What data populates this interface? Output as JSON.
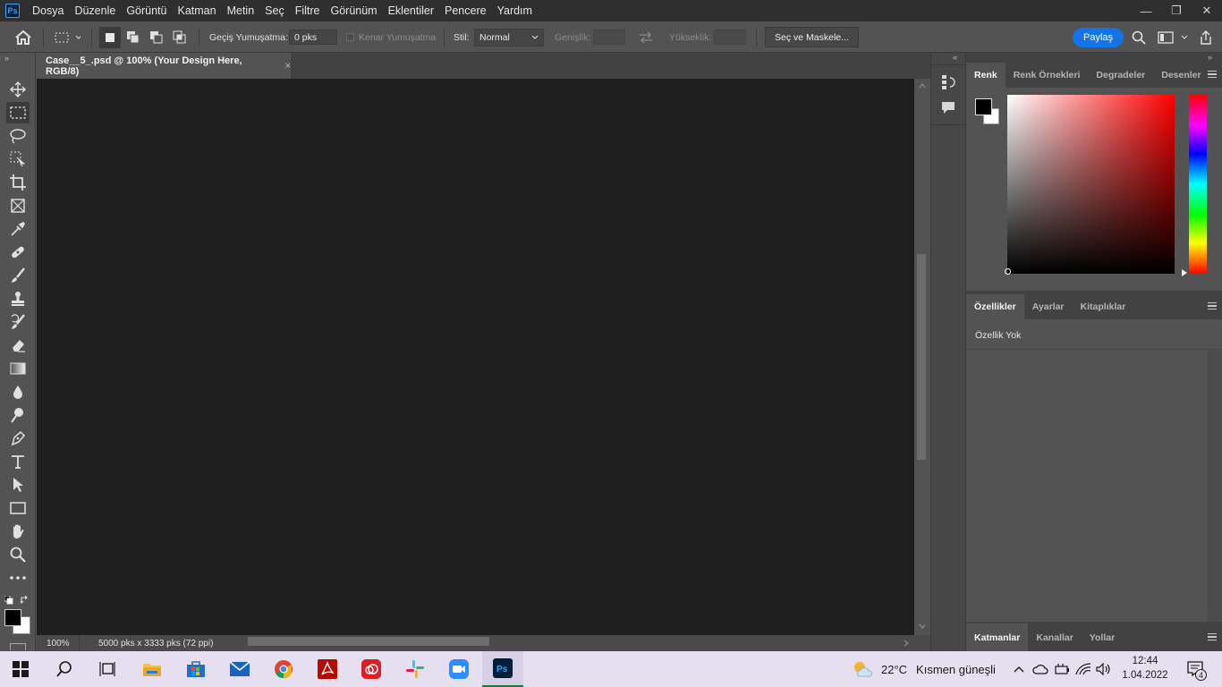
{
  "app": {
    "logo_text": "Ps"
  },
  "menubar": {
    "items": [
      "Dosya",
      "Düzenle",
      "Görüntü",
      "Katman",
      "Metin",
      "Seç",
      "Filtre",
      "Görünüm",
      "Eklentiler",
      "Pencere",
      "Yardım"
    ]
  },
  "window_controls": {
    "minimize": "—",
    "restore": "❐",
    "close": "✕"
  },
  "options": {
    "feather_label": "Geçiş Yumuşatma:",
    "feather_value": "0 pks",
    "antialias_label": "Kenar Yumuşatma",
    "style_label": "Stil:",
    "style_value": "Normal",
    "width_label": "Genişlik:",
    "height_label": "Yükseklik:",
    "select_mask_label": "Seç ve Maskele...",
    "share_label": "Paylaş"
  },
  "document": {
    "tab_title": "Case__5_.psd @ 100% (Your Design Here, RGB/8)",
    "tab_close": "×",
    "zoom": "100%",
    "info": "5000 pks x 3333 pks (72 ppi)"
  },
  "panels": {
    "color_tabs": [
      "Renk",
      "Renk Örnekleri",
      "Degradeler",
      "Desenler"
    ],
    "props_tabs": [
      "Özellikler",
      "Ayarlar",
      "Kitaplıklar"
    ],
    "props_empty": "Özellik Yok",
    "layers_tabs": [
      "Katmanlar",
      "Kanallar",
      "Yollar"
    ]
  },
  "colors": {
    "foreground": "#000000",
    "background": "#ffffff",
    "accent": "#1473e6",
    "canvas": "#1f1f1f"
  },
  "taskbar": {
    "weather_temp": "22°C",
    "weather_text": "Kısmen güneşli",
    "time": "12:44",
    "date": "1.04.2022",
    "notification_count": "4"
  }
}
